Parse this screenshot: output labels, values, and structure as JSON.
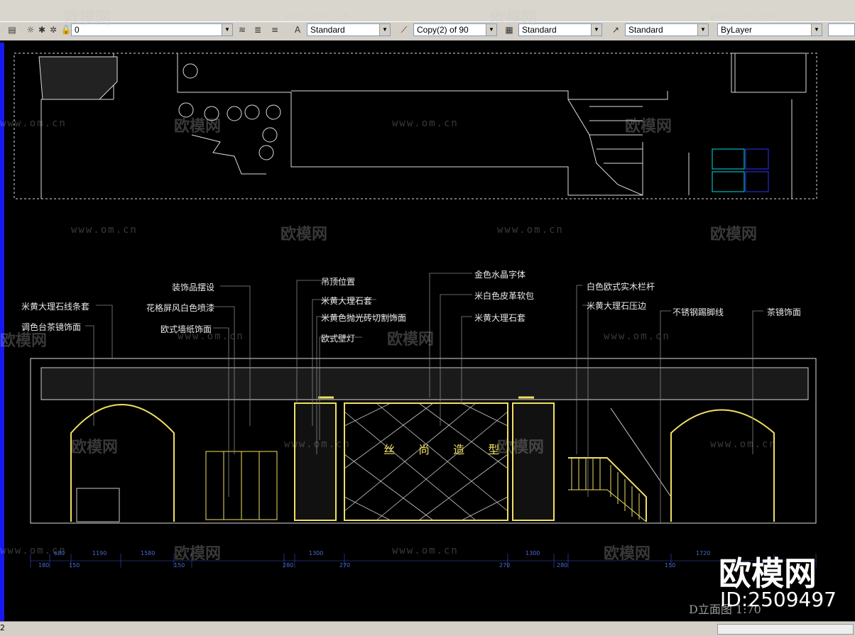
{
  "toolbar": {
    "layer_value": "0",
    "text_style": "Standard",
    "dim_style": "Copy(2) of 90",
    "table_style": "Standard",
    "mleader_style": "Standard",
    "color_value": "ByLayer"
  },
  "drawing": {
    "center_title": "丝 尚 造 型",
    "view_title": "D立面图 1:70",
    "labels": [
      "米黄大理石线条套",
      "调色台茶镜饰面",
      "装饰品摆设",
      "花格屏风白色喷漆",
      "欧式墙纸饰面",
      "吊顶位置",
      "米黄大理石套",
      "米黄色抛光砖切割饰面",
      "欧式壁灯",
      "金色水晶字体",
      "米白色皮革软包",
      "米黄大理石套",
      "白色欧式实木栏杆",
      "米黄大理石压边",
      "不锈钢踢脚线",
      "茶镜饰面"
    ],
    "dimensions_top": [
      "680",
      "1190",
      "1580",
      "1300",
      "1300",
      "1720"
    ],
    "dimensions_bottom": [
      "180",
      "150",
      "150",
      "280",
      "270",
      "270",
      "280",
      "150"
    ]
  },
  "watermark": {
    "url": "www.om.cn",
    "logo": "欧模网"
  },
  "brand": {
    "name": "欧模网",
    "id": "ID:2509497"
  },
  "status": {
    "tab": "2"
  }
}
